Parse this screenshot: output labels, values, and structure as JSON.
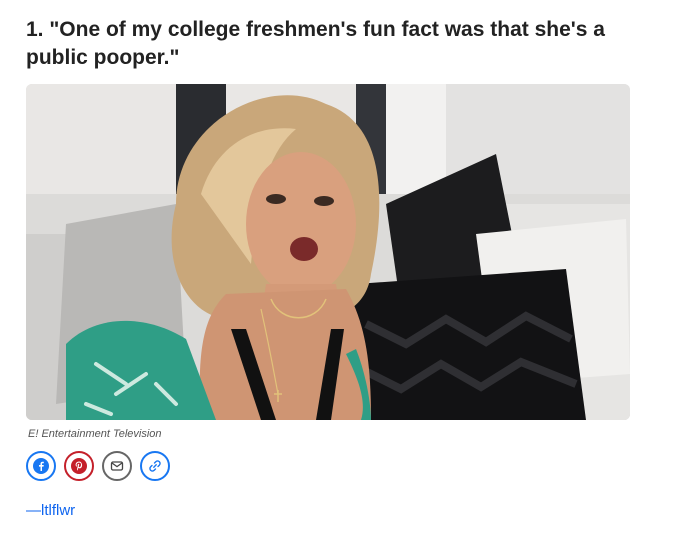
{
  "article": {
    "headline": "1. \"One of my college freshmen's fun fact was that she's a public pooper.\"",
    "image_credit": "E! Entertainment Television",
    "attribution": "—ltlflwr"
  },
  "share": {
    "buttons": [
      {
        "name": "facebook",
        "icon": "facebook-icon",
        "color": "#1877f2"
      },
      {
        "name": "pinterest",
        "icon": "pinterest-icon",
        "color": "#c4202a"
      },
      {
        "name": "email",
        "icon": "envelope-icon",
        "color": "#666666"
      },
      {
        "name": "copy-link",
        "icon": "link-icon",
        "color": "#1877f2"
      }
    ]
  },
  "colors": {
    "link": "#0f65ef",
    "text": "#222222"
  }
}
